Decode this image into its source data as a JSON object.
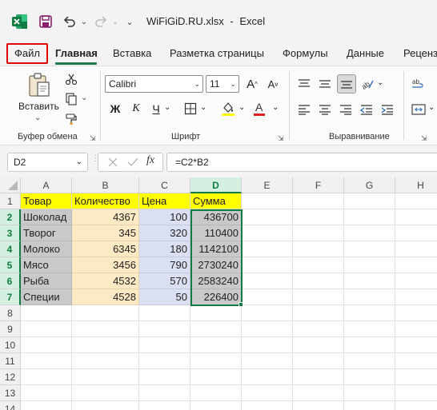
{
  "titlebar": {
    "filename": "WiFiGiD.RU.xlsx",
    "separator": "-",
    "app": "Excel"
  },
  "tabs": [
    {
      "label": "Файл",
      "highlighted": true
    },
    {
      "label": "Главная",
      "active": true
    },
    {
      "label": "Вставка"
    },
    {
      "label": "Разметка страницы"
    },
    {
      "label": "Формулы"
    },
    {
      "label": "Данные"
    },
    {
      "label": "Реценз"
    }
  ],
  "ribbon": {
    "clipboard": {
      "paste_label": "Вставить",
      "group_label": "Буфер обмена"
    },
    "font": {
      "family": "Calibri",
      "size": "11",
      "bold": "Ж",
      "italic": "К",
      "underline": "Ч",
      "group_label": "Шрифт",
      "font_color": "#e02020",
      "fill_color": "#ffff00"
    },
    "alignment": {
      "group_label": "Выравнивание"
    }
  },
  "formula_bar": {
    "name_box": "D2",
    "formula": "=C2*B2",
    "fx_label": "fx"
  },
  "columns": [
    "A",
    "B",
    "C",
    "D",
    "E",
    "F",
    "G",
    "H"
  ],
  "rows": [
    "1",
    "2",
    "3",
    "4",
    "5",
    "6",
    "7",
    "8",
    "9",
    "10",
    "11",
    "12",
    "13",
    "14"
  ],
  "table": {
    "headers": [
      "Товар",
      "Количество",
      "Цена",
      "Сумма"
    ],
    "rows": [
      [
        "Шоколад",
        "4367",
        "100",
        "436700"
      ],
      [
        "Творог",
        "345",
        "320",
        "110400"
      ],
      [
        "Молоко",
        "6345",
        "180",
        "1142100"
      ],
      [
        "Мясо",
        "3456",
        "790",
        "2730240"
      ],
      [
        "Рыба",
        "4532",
        "570",
        "2583240"
      ],
      [
        "Специи",
        "4528",
        "50",
        "226400"
      ]
    ]
  },
  "selected_cell": "D2",
  "colors": {
    "excel_green": "#107c41",
    "header_fill": "#ffff00",
    "product_fill": "#c9c9c9",
    "qty_fill": "#fde9c4",
    "price_fill": "#dae0f1",
    "sum_fill": "#c9c9c9"
  }
}
